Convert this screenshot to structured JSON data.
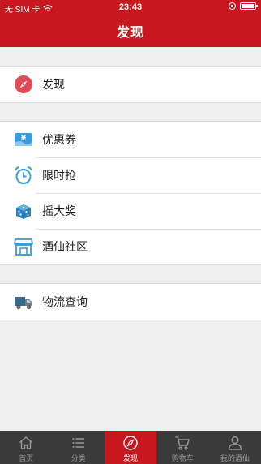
{
  "status_bar": {
    "carrier": "无 SIM 卡",
    "time": "23:43"
  },
  "nav": {
    "title": "发现"
  },
  "groups": [
    {
      "items": [
        {
          "label": "发现",
          "icon": "compass-icon"
        }
      ]
    },
    {
      "items": [
        {
          "label": "优惠券",
          "icon": "coupon-icon"
        },
        {
          "label": "限时抢",
          "icon": "alarm-clock-icon"
        },
        {
          "label": "摇大奖",
          "icon": "dice-icon"
        },
        {
          "label": "酒仙社区",
          "icon": "storefront-icon"
        }
      ]
    },
    {
      "items": [
        {
          "label": "物流查询",
          "icon": "delivery-truck-icon"
        }
      ]
    }
  ],
  "tabbar": {
    "tabs": [
      {
        "label": "首页",
        "icon": "home-icon"
      },
      {
        "label": "分类",
        "icon": "list-icon"
      },
      {
        "label": "发现",
        "icon": "compass-icon",
        "active": true
      },
      {
        "label": "购物车",
        "icon": "cart-icon"
      },
      {
        "label": "我的酒仙",
        "icon": "user-icon"
      }
    ]
  },
  "colors": {
    "brand_red": "#c8171f",
    "tabbar_bg": "#3a3a3a",
    "icon_blue": "#3a9ad9",
    "background": "#efefef"
  }
}
